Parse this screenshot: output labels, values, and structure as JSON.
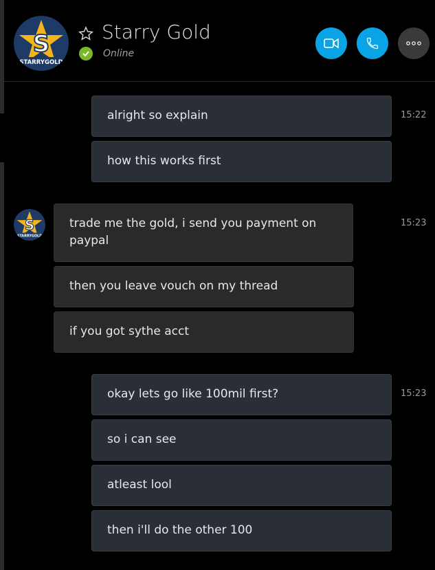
{
  "contact": {
    "name": "Starry Gold",
    "status": "Online",
    "logo_text": "STARRYGOLD"
  },
  "icons": {
    "favorite": "star-outline-icon",
    "presence": "checkmark-icon",
    "video": "video-camera-icon",
    "call": "phone-icon",
    "more": "ellipsis-icon"
  },
  "colors": {
    "accent": "#0aa4e6",
    "online": "#79b829",
    "bubble_out": "#2a2f37",
    "bubble_in": "#2a2a2a"
  },
  "messages": {
    "g1": {
      "time": "15:22",
      "m1": "alright so explain",
      "m2": "how this works first"
    },
    "g2": {
      "time": "15:23",
      "m1": "trade me the gold, i send you payment on paypal",
      "m2": "then you leave vouch on  my thread",
      "m3": "if you got sythe acct"
    },
    "g3": {
      "time": "15:23",
      "m1": "okay lets go like 100mil first?",
      "m2": "so i can see",
      "m3": "atleast lool",
      "m4": "then i'll do the other 100"
    }
  }
}
